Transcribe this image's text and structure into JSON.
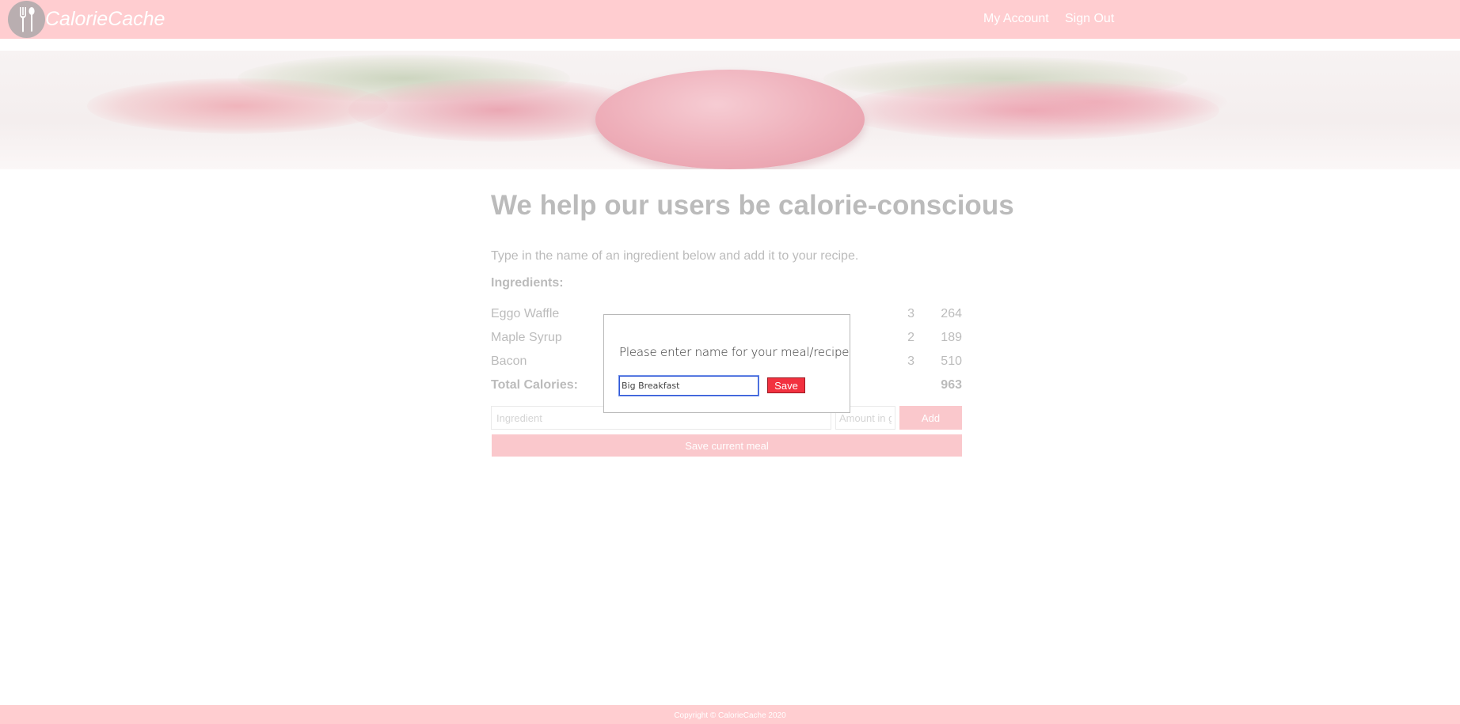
{
  "header": {
    "brand": "CalorieCache",
    "nav": {
      "my_account": "My Account",
      "sign_out": "Sign Out"
    }
  },
  "main": {
    "headline": "We help our users be calorie-conscious",
    "intro": "Type in the name of an ingredient below and add it to your recipe.",
    "ingredients_label": "Ingredients:",
    "ingredients": [
      {
        "name": "Eggo Waffle",
        "qty": "3",
        "calories": "264"
      },
      {
        "name": "Maple Syrup",
        "qty": "2",
        "calories": "189"
      },
      {
        "name": "Bacon",
        "qty": "3",
        "calories": "510"
      }
    ],
    "total_label": "Total Calories:",
    "total_value": "963",
    "ingredient_placeholder": "Ingredient",
    "amount_placeholder": "Amount in g",
    "add_label": "Add",
    "save_meal_label": "Save current meal"
  },
  "modal": {
    "prompt": "Please enter name for your meal/recipe",
    "input_value": "Big Breakfast",
    "save_label": "Save"
  },
  "footer": {
    "copyright": "Copyright © CalorieCache 2020"
  },
  "colors": {
    "brand_pink": "#ffcdd0",
    "accent_red": "#f2313f"
  },
  "icons": {
    "logo": "fork-knife-icon"
  }
}
